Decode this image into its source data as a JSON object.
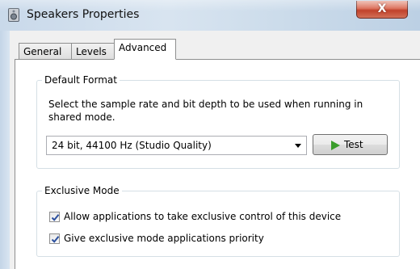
{
  "window": {
    "title": "Speakers Properties",
    "close_glyph": "X",
    "icon": "speaker-icon"
  },
  "tabs": [
    {
      "label": "General",
      "active": false
    },
    {
      "label": "Levels",
      "active": false
    },
    {
      "label": "Advanced",
      "active": true
    }
  ],
  "default_format": {
    "title": "Default Format",
    "description": "Select the sample rate and bit depth to be used when running in shared mode.",
    "format_select": {
      "value": "24 bit, 44100 Hz (Studio Quality)"
    },
    "test_button": {
      "label": "Test",
      "icon": "play-icon"
    }
  },
  "exclusive_mode": {
    "title": "Exclusive Mode",
    "options": [
      {
        "label": "Allow applications to take exclusive control of this device",
        "checked": true
      },
      {
        "label": "Give exclusive mode applications priority",
        "checked": true
      }
    ]
  },
  "colors": {
    "play_icon": "#3a9d2b",
    "close_button": "#c03f28",
    "checkmark": "#2b4f9e"
  }
}
